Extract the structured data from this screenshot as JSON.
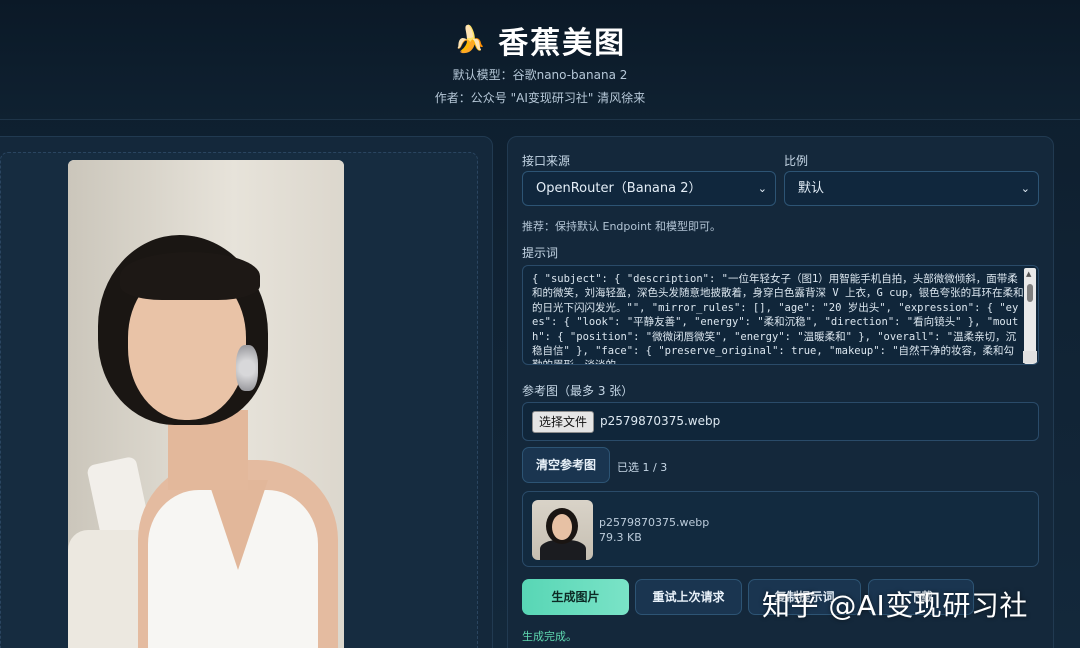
{
  "header": {
    "logo_icon": "banana-icon",
    "logo_glyph": "🍌",
    "title": "香蕉美图",
    "default_model": "默认模型：谷歌nano-banana 2",
    "author": "作者：公众号 \"AI变现研习社\"  清风徐来"
  },
  "form": {
    "source_label": "接口来源",
    "source_value": "OpenRouter（Banana 2）",
    "ratio_label": "比例",
    "ratio_value": "默认",
    "hint": "推荐：保持默认 Endpoint 和模型即可。",
    "prompt_label": "提示词",
    "prompt_value": "{ \"subject\": { \"description\": \"一位年轻女子（图1）用智能手机自拍，头部微微倾斜，面带柔和的微笑，刘海轻盈，深色头发随意地披散着，身穿白色露背深 V 上衣，G cup，银色夸张的耳环在柔和的日光下闪闪发光。\"\", \"mirror_rules\": [], \"age\": \"20 岁出头\", \"expression\": { \"eyes\": { \"look\": \"平静友善\", \"energy\": \"柔和沉稳\", \"direction\": \"看向镜头\" }, \"mouth\": { \"position\": \"微微闭唇微笑\", \"energy\": \"温暖柔和\" }, \"overall\": \"温柔亲切，沉稳自信\" }, \"face\": { \"preserve_original\": true, \"makeup\": \"自然干净的妆容，柔和勾勒的眉形，淡淡的",
    "ref_label": "参考图（最多 3 张）",
    "file_button": "选择文件",
    "file_name": "p2579870375.webp",
    "clear_button": "清空参考图",
    "selected_count": "已选 1 / 3",
    "thumb_name": "p2579870375.webp",
    "thumb_size": "79.3 KB"
  },
  "actions": {
    "generate": "生成图片",
    "retry": "重试上次请求",
    "third": "复制提示词",
    "fourth": "下载"
  },
  "status": "生成完成。",
  "watermark": "知乎 @AI变现研习社",
  "colors": {
    "accent": "#58d6b5",
    "background": "#102233",
    "panel": "#14283b"
  }
}
